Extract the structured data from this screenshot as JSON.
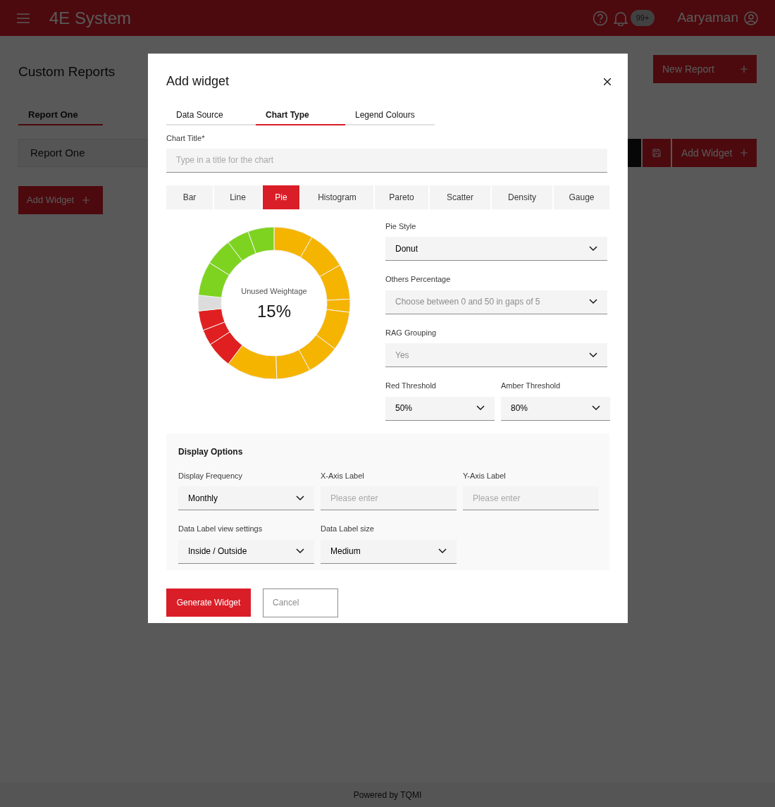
{
  "header": {
    "title": "4E System",
    "notification_badge": "99+",
    "user_name": "Aaryaman"
  },
  "page": {
    "title": "Custom Reports",
    "new_report_button": "New Report",
    "tabs": [
      {
        "label": "Report One",
        "selected": true
      }
    ],
    "report_name": "Report One",
    "add_widget_button": "Add Widget",
    "toolbar_add_widget_button": "Add Widget"
  },
  "modal": {
    "title": "Add widget",
    "tabs": [
      {
        "label": "Data Source",
        "selected": false
      },
      {
        "label": "Chart Type",
        "selected": true
      },
      {
        "label": "Legend Colours",
        "selected": false
      }
    ],
    "chart_title": {
      "label": "Chart Title*",
      "placeholder": "Type in a title for the chart"
    },
    "chart_types": [
      {
        "label": "Bar",
        "selected": false
      },
      {
        "label": "Line",
        "selected": false
      },
      {
        "label": "Pie",
        "selected": true
      },
      {
        "label": "Histogram",
        "selected": false
      },
      {
        "label": "Pareto",
        "selected": false
      },
      {
        "label": "Scatter",
        "selected": false
      },
      {
        "label": "Density",
        "selected": false
      },
      {
        "label": "Gauge",
        "selected": false
      }
    ],
    "donut_center": {
      "label": "Unused Weightage",
      "value": "15%"
    },
    "settings": [
      {
        "label": "Pie Style",
        "value": "Donut"
      },
      {
        "label": "Others Percentage",
        "placeholder": "Choose between 0 and 50 in gaps of 5"
      },
      {
        "label": "RAG Grouping",
        "placeholder": "Yes"
      }
    ],
    "thresholds": [
      {
        "label": "Red Threshold",
        "value": "50%"
      },
      {
        "label": "Amber Threshold",
        "value": "80%"
      }
    ],
    "display_options": {
      "title": "Display Options",
      "fields": [
        {
          "kind": "select",
          "label": "Display Frequency",
          "value": "Monthly"
        },
        {
          "kind": "input",
          "label": "X-Axis Label",
          "placeholder": "Please enter"
        },
        {
          "kind": "input",
          "label": "Y-Axis Label",
          "placeholder": "Please enter"
        },
        {
          "kind": "select",
          "label": "Data Label view settings",
          "value": "Inside / Outside"
        },
        {
          "kind": "select",
          "label": "Data Label size",
          "value": "Medium"
        }
      ]
    },
    "generate_button": "Generate Widget",
    "cancel_button": "Cancel"
  },
  "footer": {
    "text": "Powered by TQMI"
  }
}
